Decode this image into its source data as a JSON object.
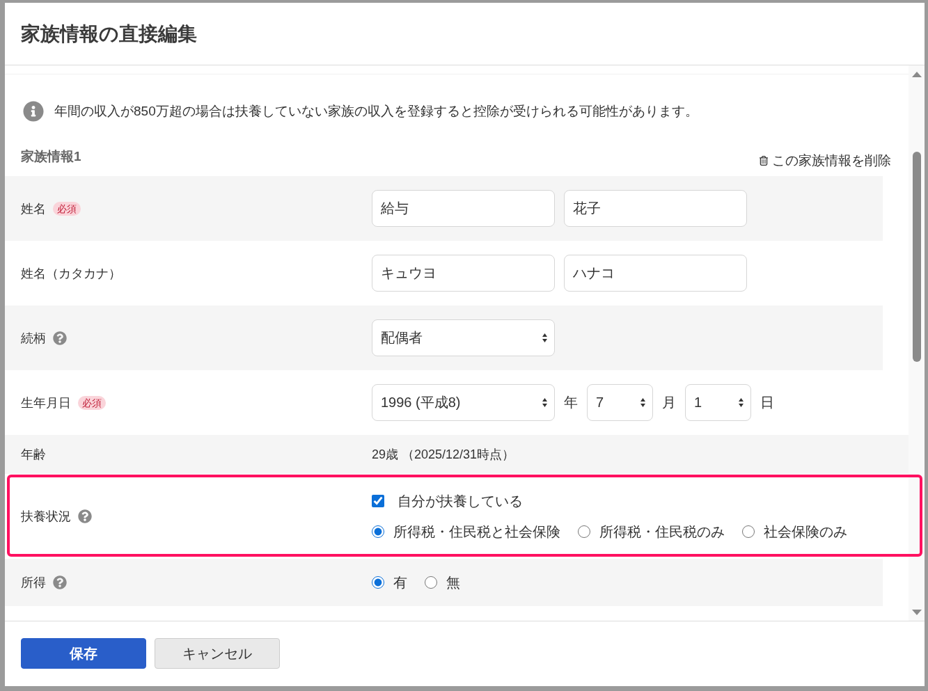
{
  "dialog": {
    "title": "家族情報の直接編集"
  },
  "notice": {
    "text": "年間の収入が850万超の場合は扶養していない家族の収入を登録すると控除が受けられる可能性があります。"
  },
  "section": {
    "title": "家族情報1",
    "delete_link": "この家族情報を削除"
  },
  "rows": [
    {
      "kind": "text_pair",
      "label": "姓名",
      "required_badge": "必須",
      "help": false,
      "highlighted": false,
      "values": [
        "給与",
        "花子"
      ]
    },
    {
      "kind": "text_pair",
      "label": "姓名（カタカナ）",
      "help": false,
      "highlighted": false,
      "values": [
        "キュウヨ",
        "ハナコ"
      ]
    },
    {
      "kind": "select",
      "label": "続柄",
      "help": true,
      "highlighted": false,
      "value": "配偶者"
    },
    {
      "kind": "date",
      "label": "生年月日",
      "required_badge": "必須",
      "help": false,
      "highlighted": false,
      "parts": [
        {
          "value": "1996 (平成8)",
          "unit": "年"
        },
        {
          "value": "7",
          "unit": "月"
        },
        {
          "value": "1",
          "unit": "日"
        }
      ]
    },
    {
      "kind": "static",
      "label": "年齢",
      "help": false,
      "highlighted": false,
      "text": "29歳 （2025/12/31時点）"
    },
    {
      "kind": "choices",
      "label": "扶養状況",
      "help": true,
      "highlighted": true,
      "checkbox": {
        "label": "自分が扶養している",
        "checked": true
      },
      "options": [
        {
          "label": "所得税・住民税と社会保険",
          "selected": true
        },
        {
          "label": "所得税・住民税のみ",
          "selected": false
        },
        {
          "label": "社会保険のみ",
          "selected": false
        }
      ]
    },
    {
      "kind": "choices",
      "label": "所得",
      "help": true,
      "highlighted": false,
      "options": [
        {
          "label": "有",
          "selected": true
        },
        {
          "label": "無",
          "selected": false
        }
      ]
    }
  ],
  "buttons": [
    {
      "kind": "primary",
      "label": "保存"
    },
    {
      "kind": "secondary",
      "label": "キャンセル"
    }
  ]
}
